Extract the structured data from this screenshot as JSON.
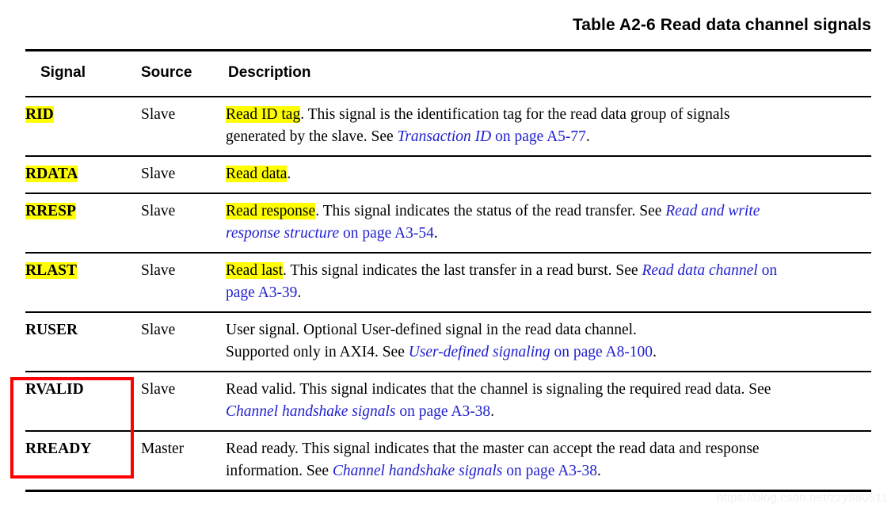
{
  "caption": "Table A2-6 Read data channel signals",
  "watermark": "https://blog.csdn.net/zzy980511",
  "accent_colors": {
    "highlight": "#ffff00",
    "link": "#2020d0",
    "annotation_box": "#ff0000",
    "rule": "#000000"
  },
  "columns": {
    "signal": "Signal",
    "source": "Source",
    "description": "Description"
  },
  "rows": [
    {
      "signal": "RID",
      "signal_highlighted": true,
      "source": "Slave",
      "description_plain": "Read ID tag. This signal is the identification tag for the read data group of signals generated by the slave. See Transaction ID on page A5-77.",
      "lines": [
        {
          "id": "r1l1",
          "text": "Read ID tag. This signal is the identification tag for the read data group of signals"
        },
        {
          "id": "r1l2",
          "text": "generated by the slave. See Transaction ID on page A5-77."
        }
      ],
      "highlight_phrase": "Read ID tag",
      "link_italic": "Transaction ID",
      "link_page": "on page A5-77"
    },
    {
      "signal": "RDATA",
      "signal_highlighted": true,
      "source": "Slave",
      "description_plain": "Read data.",
      "lines": [
        {
          "id": "r2l1",
          "text": "Read data."
        }
      ],
      "highlight_phrase": "Read data",
      "link_italic": "",
      "link_page": ""
    },
    {
      "signal": "RRESP",
      "signal_highlighted": true,
      "source": "Slave",
      "description_plain": "Read response. This signal indicates the status of the read transfer. See Read and write response structure on page A3-54.",
      "lines": [
        {
          "id": "r3l1",
          "text": "Read response. This signal indicates the status of the read transfer. See Read and write"
        },
        {
          "id": "r3l2",
          "text": "response structure on page A3-54."
        }
      ],
      "highlight_phrase": "Read response",
      "link_italic": "Read and write response structure",
      "link_page": "on page A3-54"
    },
    {
      "signal": "RLAST",
      "signal_highlighted": true,
      "source": "Slave",
      "description_plain": "Read last. This signal indicates the last transfer in a read burst. See Read data channel on page A3-39.",
      "lines": [
        {
          "id": "r4l1",
          "text": "Read last. This signal indicates the last transfer in a read burst. See Read data channel on"
        },
        {
          "id": "r4l2",
          "text": "page A3-39."
        }
      ],
      "highlight_phrase": "Read last",
      "link_italic": "Read data channel",
      "link_page": "on page A3-39"
    },
    {
      "signal": "RUSER",
      "signal_highlighted": false,
      "source": "Slave",
      "description_plain": "User signal. Optional User-defined signal in the read data channel. Supported only in AXI4. See User-defined signaling on page A8-100.",
      "lines": [
        {
          "id": "r5l1",
          "text": "User signal. Optional User-defined signal in the read data channel."
        },
        {
          "id": "r5l2",
          "text": "Supported only in AXI4. See User-defined signaling on page A8-100."
        }
      ],
      "highlight_phrase": "",
      "link_italic": "User-defined signaling",
      "link_page": "on page A8-100"
    },
    {
      "signal": "RVALID",
      "signal_highlighted": false,
      "source": "Slave",
      "description_plain": "Read valid. This signal indicates that the channel is signaling the required read data. See Channel handshake signals on page A3-38.",
      "lines": [
        {
          "id": "r6l1",
          "text": "Read valid. This signal indicates that the channel is signaling the required read data. See"
        },
        {
          "id": "r6l2",
          "text": "Channel handshake signals on page A3-38."
        }
      ],
      "highlight_phrase": "",
      "link_italic": "Channel handshake signals",
      "link_page": "on page A3-38"
    },
    {
      "signal": "RREADY",
      "signal_highlighted": false,
      "source": "Master",
      "description_plain": "Read ready. This signal indicates that the master can accept the read data and response information. See Channel handshake signals on page A3-38.",
      "lines": [
        {
          "id": "r7l1",
          "text": "Read ready. This signal indicates that the master can accept the read data and response"
        },
        {
          "id": "r7l2",
          "text": "information. See Channel handshake signals on page A3-38."
        }
      ],
      "highlight_phrase": "",
      "link_italic": "Channel handshake signals",
      "link_page": "on page A3-38"
    }
  ],
  "annotation": {
    "label": "red-box-around-rvalid-rready-signal-names"
  },
  "text_fragments": {
    "r1_a": "Read ID tag",
    "r1_b": ". This signal is the identification tag for the read data group of signals",
    "r1_c": "generated by the slave. See ",
    "r1_d": "Transaction ID",
    "r1_e": " on page A5-77",
    "r1_f": ".",
    "r2_a": "Read data",
    "r2_b": ".",
    "r3_a": "Read response",
    "r3_b": ". This signal indicates the status of the read transfer. See ",
    "r3_c": "Read and write",
    "r3_d": "response structure",
    "r3_e": " on page A3-54",
    "r3_f": ".",
    "r4_a": "Read last",
    "r4_b": ". This signal indicates the last transfer in a read burst. See ",
    "r4_c": "Read data channel",
    "r4_d": " on",
    "r4_e": "page A3-39",
    "r4_f": ".",
    "r5_a": "User signal. Optional User-defined signal in the read data channel.",
    "r5_b": "Supported only in AXI4. See ",
    "r5_c": "User-defined signaling",
    "r5_d": " on page A8-100",
    "r5_e": ".",
    "r6_a": "Read valid. This signal indicates that the channel is signaling the required read data. See",
    "r6_b": "Channel handshake signals",
    "r6_c": " on page A3-38",
    "r6_d": ".",
    "r7_a": "Read ready. This signal indicates that the master can accept the read data and response",
    "r7_b": "information. See ",
    "r7_c": "Channel handshake signals",
    "r7_d": " on page A3-38",
    "r7_e": "."
  }
}
